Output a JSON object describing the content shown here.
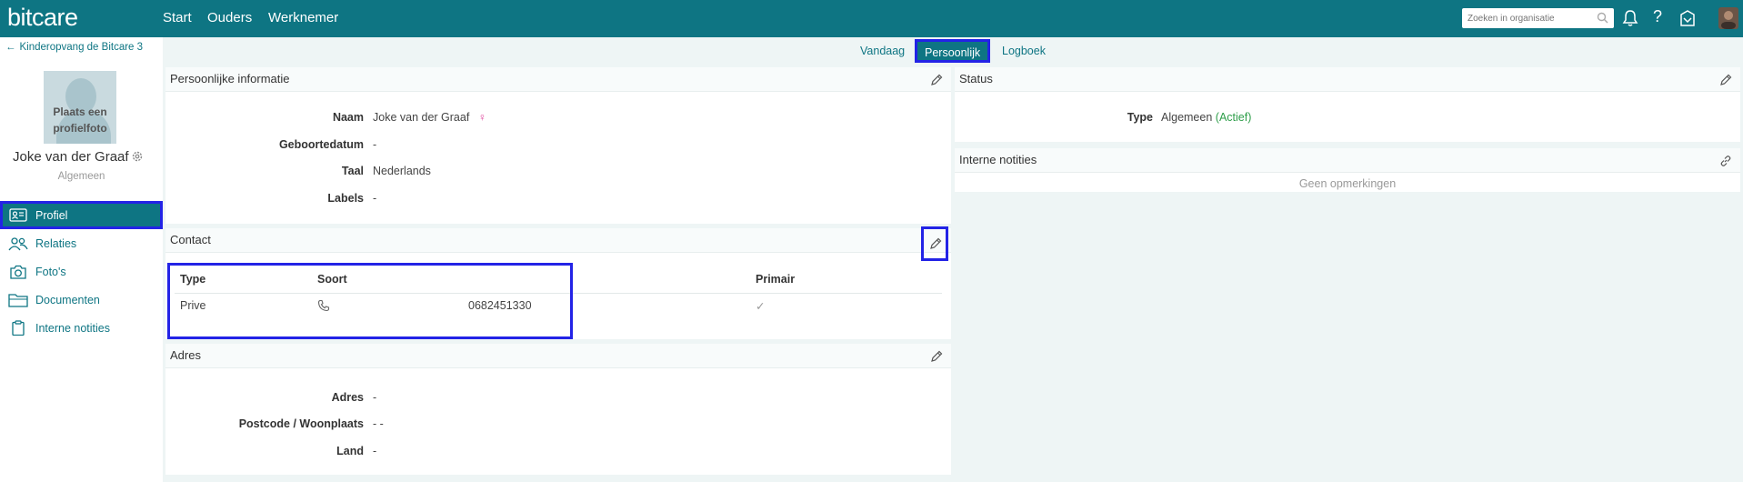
{
  "header": {
    "logo": "bitcare",
    "nav": [
      "Start",
      "Ouders",
      "Werknemer"
    ],
    "search_placeholder": "Zoeken in organisatie"
  },
  "sidebar": {
    "back_label": "Kinderopvang de Bitcare 3",
    "photo_label": "Plaats een profielfoto",
    "name": "Joke van der Graaf",
    "role": "Algemeen",
    "items": [
      {
        "label": "Profiel",
        "icon": "id-card-icon"
      },
      {
        "label": "Relaties",
        "icon": "people-icon"
      },
      {
        "label": "Foto's",
        "icon": "camera-icon"
      },
      {
        "label": "Documenten",
        "icon": "folder-icon"
      },
      {
        "label": "Interne notities",
        "icon": "clipboard-icon"
      }
    ]
  },
  "tabs": [
    "Vandaag",
    "Persoonlijk",
    "Logboek"
  ],
  "personal": {
    "title": "Persoonlijke informatie",
    "fields": [
      {
        "label": "Naam",
        "value": "Joke van der Graaf"
      },
      {
        "label": "Geboortedatum",
        "value": "-"
      },
      {
        "label": "Taal",
        "value": "Nederlands"
      },
      {
        "label": "Labels",
        "value": "-"
      }
    ]
  },
  "contact": {
    "title": "Contact",
    "columns": [
      "Type",
      "Soort",
      "Primair"
    ],
    "rows": [
      {
        "type": "Prive",
        "soort_icon": "phone-icon",
        "value": "0682451330",
        "primair": "✓"
      }
    ]
  },
  "address": {
    "title": "Adres",
    "fields": [
      {
        "label": "Adres",
        "value": "-"
      },
      {
        "label": "Postcode / Woonplaats",
        "value": "- -"
      },
      {
        "label": "Land",
        "value": "-"
      }
    ]
  },
  "status": {
    "title": "Status",
    "type_label": "Type",
    "type_value": "Algemeen",
    "type_state": "(Actief)"
  },
  "notes": {
    "title": "Interne notities",
    "empty": "Geen opmerkingen"
  },
  "colors": {
    "primary": "#0e7583",
    "highlight": "#2323e6",
    "female_symbol": "#e0479e",
    "active_status": "#2e9e4a"
  }
}
